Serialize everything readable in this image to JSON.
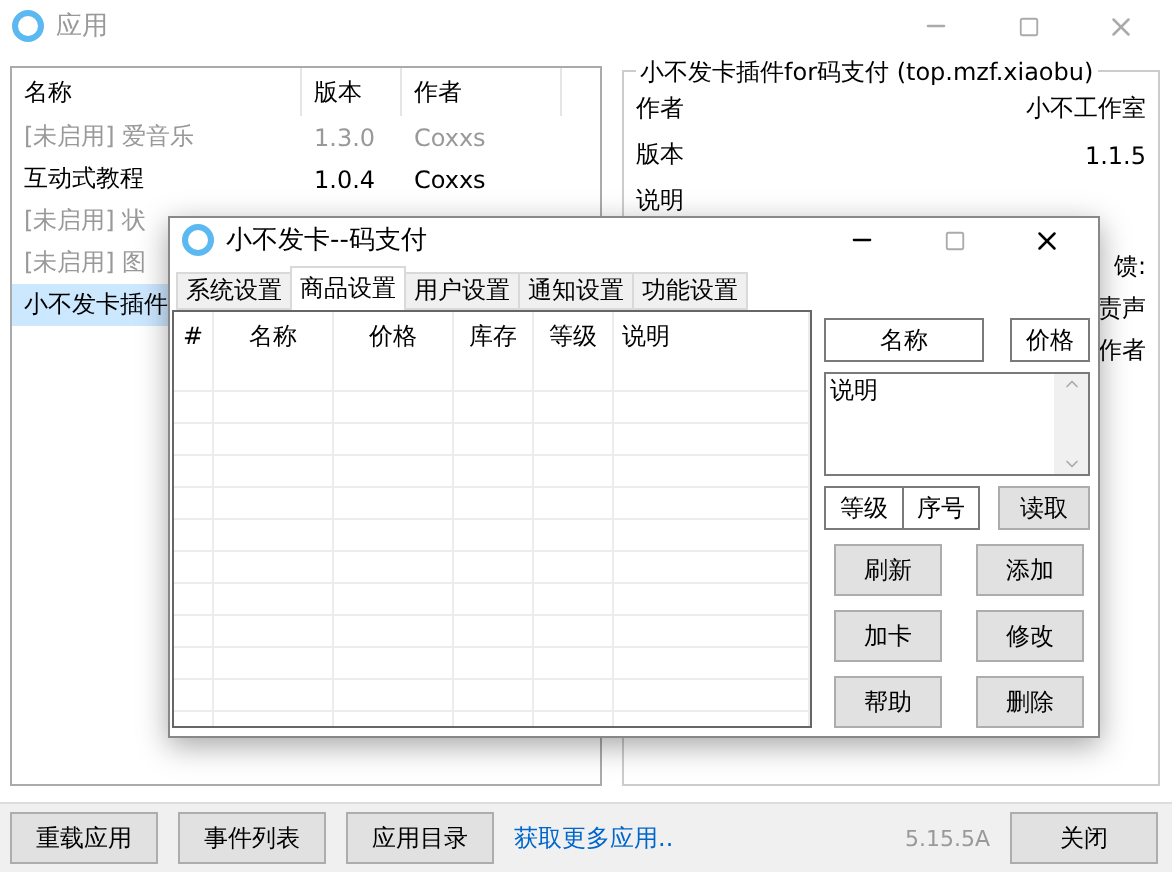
{
  "window": {
    "title": "应用"
  },
  "apps_table": {
    "columns": [
      "名称",
      "版本",
      "作者"
    ],
    "rows": [
      {
        "name": "[未启用] 爱音乐",
        "version": "1.3.0",
        "author": "Coxxs",
        "enabled": false,
        "selected": false
      },
      {
        "name": "互动式教程",
        "version": "1.0.4",
        "author": "Coxxs",
        "enabled": true,
        "selected": false
      },
      {
        "name": "[未启用] 状",
        "enabled": false,
        "selected": false
      },
      {
        "name": "[未启用] 图",
        "enabled": false,
        "selected": false
      },
      {
        "name": "小不发卡插件",
        "enabled": true,
        "selected": true
      }
    ]
  },
  "details": {
    "title": "小不发卡插件for码支付 (top.mzf.xiaobu)",
    "fields": [
      {
        "label": "作者",
        "value": "小不工作室"
      },
      {
        "label": "版本",
        "value": "1.1.5"
      },
      {
        "label": "说明"
      }
    ],
    "fragments": [
      "馈:",
      "责声",
      "作者"
    ]
  },
  "footer": {
    "buttons": [
      "重载应用",
      "事件列表",
      "应用目录"
    ],
    "link": "获取更多应用..",
    "version": "5.15.5A",
    "close": "关闭"
  },
  "dialog": {
    "title": "小不发卡--码支付",
    "tabs": [
      {
        "label": "系统设置",
        "selected": false
      },
      {
        "label": "商品设置",
        "selected": true
      },
      {
        "label": "用户设置",
        "selected": false
      },
      {
        "label": "通知设置",
        "selected": false
      },
      {
        "label": "功能设置",
        "selected": false
      }
    ],
    "table": {
      "columns": [
        "#",
        "名称",
        "价格",
        "库存",
        "等级",
        "说明"
      ]
    },
    "name_field": "名称",
    "price_field": "价格",
    "description_field": "说明",
    "level_field": "等级",
    "index_field": "序号",
    "read_button": "读取",
    "buttons": [
      "刷新",
      "添加",
      "加卡",
      "修改",
      "帮助",
      "删除"
    ]
  }
}
